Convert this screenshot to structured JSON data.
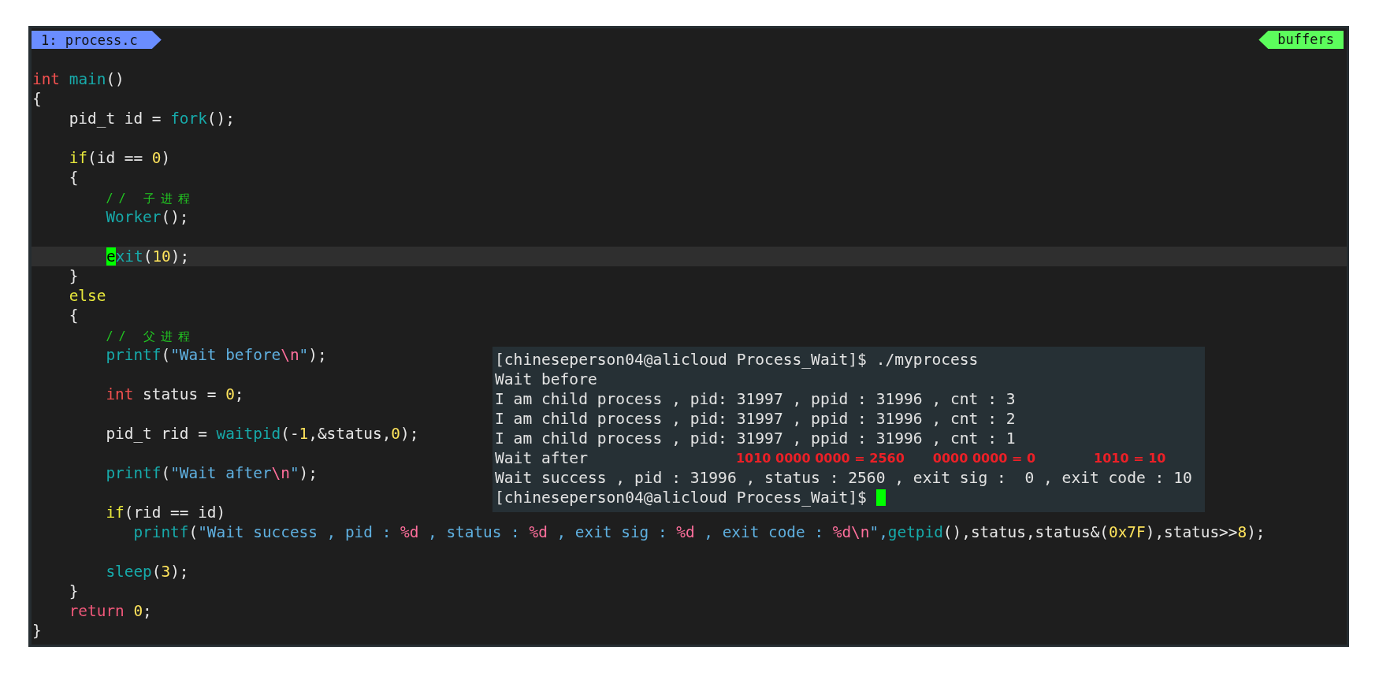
{
  "tabline": {
    "tabs": [
      {
        "label": "1: process.c",
        "selected": true
      }
    ],
    "buffers_label": "buffers"
  },
  "code": {
    "lines": [
      {
        "current": false,
        "tokens": [
          {
            "text": "int",
            "kind": "type"
          },
          {
            "text": " main",
            "kind": "func"
          },
          {
            "text": "()",
            "kind": "plain"
          }
        ]
      },
      {
        "current": false,
        "tokens": [
          {
            "text": "{",
            "kind": "plain"
          }
        ]
      },
      {
        "current": false,
        "tokens": [
          {
            "text": "    pid_t id = ",
            "kind": "plain"
          },
          {
            "text": "fork",
            "kind": "func"
          },
          {
            "text": "();",
            "kind": "plain"
          }
        ]
      },
      {
        "current": false
      },
      {
        "current": false,
        "tokens": [
          {
            "text": "    if",
            "kind": "cond"
          },
          {
            "text": "(id == ",
            "kind": "plain"
          },
          {
            "text": "0",
            "kind": "number"
          },
          {
            "text": ")",
            "kind": "plain"
          }
        ]
      },
      {
        "current": false,
        "tokens": [
          {
            "text": "    {",
            "kind": "plain"
          }
        ]
      },
      {
        "current": false,
        "tokens": [
          {
            "text": "        // 子进程",
            "kind": "comment"
          }
        ]
      },
      {
        "current": false,
        "tokens": [
          {
            "text": "        Worker",
            "kind": "func"
          },
          {
            "text": "();",
            "kind": "plain"
          }
        ]
      },
      {
        "current": false
      },
      {
        "current": true,
        "tokens": [
          {
            "text": "e",
            "kind": "cursor"
          },
          {
            "text": "xit",
            "kind": "func"
          },
          {
            "text": "(",
            "kind": "plain"
          },
          {
            "text": "10",
            "kind": "number"
          },
          {
            "text": ");",
            "kind": "plain"
          }
        ]
      },
      {
        "current": false,
        "tokens": [
          {
            "text": "    }",
            "kind": "plain"
          }
        ]
      },
      {
        "current": false,
        "tokens": [
          {
            "text": "    else",
            "kind": "cond"
          }
        ]
      },
      {
        "current": false,
        "tokens": [
          {
            "text": "    {",
            "kind": "plain"
          }
        ]
      },
      {
        "current": false,
        "tokens": [
          {
            "text": "        // 父进程",
            "kind": "comment"
          }
        ]
      },
      {
        "current": false,
        "tokens": [
          {
            "text": "        printf",
            "kind": "func"
          },
          {
            "text": "(",
            "kind": "plain"
          },
          {
            "text": "\"Wait before",
            "kind": "string"
          },
          {
            "text": "\\n",
            "kind": "escape"
          },
          {
            "text": "\"",
            "kind": "string"
          },
          {
            "text": ");",
            "kind": "plain"
          }
        ]
      },
      {
        "current": false
      },
      {
        "current": false,
        "tokens": [
          {
            "text": "        int",
            "kind": "type"
          },
          {
            "text": " status = ",
            "kind": "plain"
          },
          {
            "text": "0",
            "kind": "number"
          },
          {
            "text": ";",
            "kind": "plain"
          }
        ]
      },
      {
        "current": false
      },
      {
        "current": false,
        "tokens": [
          {
            "text": "        pid_t rid = ",
            "kind": "plain"
          },
          {
            "text": "waitpid",
            "kind": "func"
          },
          {
            "text": "(-",
            "kind": "plain"
          },
          {
            "text": "1",
            "kind": "number"
          },
          {
            "text": ",&status,",
            "kind": "plain"
          },
          {
            "text": "0",
            "kind": "number"
          },
          {
            "text": ");",
            "kind": "plain"
          }
        ]
      },
      {
        "current": false
      },
      {
        "current": false,
        "tokens": [
          {
            "text": "        printf",
            "kind": "func"
          },
          {
            "text": "(",
            "kind": "plain"
          },
          {
            "text": "\"Wait after",
            "kind": "string"
          },
          {
            "text": "\\n",
            "kind": "escape"
          },
          {
            "text": "\"",
            "kind": "string"
          },
          {
            "text": ");",
            "kind": "plain"
          }
        ]
      },
      {
        "current": false
      },
      {
        "current": false,
        "tokens": [
          {
            "text": "        if",
            "kind": "cond"
          },
          {
            "text": "(rid == id)",
            "kind": "plain"
          }
        ]
      },
      {
        "current": false,
        "tokens": [
          {
            "text": "           printf",
            "kind": "func"
          },
          {
            "text": "(",
            "kind": "plain"
          },
          {
            "text": "\"Wait success , pid : ",
            "kind": "string"
          },
          {
            "text": "%d",
            "kind": "escape"
          },
          {
            "text": " , status : ",
            "kind": "string"
          },
          {
            "text": "%d",
            "kind": "escape"
          },
          {
            "text": " , exit sig : ",
            "kind": "string"
          },
          {
            "text": "%d",
            "kind": "escape"
          },
          {
            "text": " , exit code : ",
            "kind": "string"
          },
          {
            "text": "%d\\n",
            "kind": "escape"
          },
          {
            "text": "\",",
            "kind": "string"
          },
          {
            "text": "getpid",
            "kind": "func"
          },
          {
            "text": "(),status,status&(",
            "kind": "plain"
          },
          {
            "text": "0x7F",
            "kind": "number"
          },
          {
            "text": "),status>>",
            "kind": "plain"
          },
          {
            "text": "8",
            "kind": "number"
          },
          {
            "text": ");",
            "kind": "plain"
          }
        ]
      },
      {
        "current": false
      },
      {
        "current": false,
        "tokens": [
          {
            "text": "        sleep",
            "kind": "func"
          },
          {
            "text": "(",
            "kind": "plain"
          },
          {
            "text": "3",
            "kind": "number"
          },
          {
            "text": ");",
            "kind": "plain"
          }
        ]
      },
      {
        "current": false,
        "tokens": [
          {
            "text": "    }",
            "kind": "plain"
          }
        ]
      },
      {
        "current": false,
        "tokens": [
          {
            "text": "    return",
            "kind": "keyword"
          },
          {
            "text": " 0",
            "kind": "number"
          },
          {
            "text": ";",
            "kind": "plain"
          }
        ]
      },
      {
        "current": false,
        "tokens": [
          {
            "text": "}",
            "kind": "plain"
          }
        ]
      }
    ]
  },
  "terminal": {
    "lines": [
      {
        "text": "[chineseperson04@alicloud Process_Wait]$ ./myprocess"
      },
      {
        "text": "Wait before"
      },
      {
        "text": "I am child process , pid: 31997 , ppid : 31996 , cnt : 3"
      },
      {
        "text": "I am child process , pid: 31997 , ppid : 31996 , cnt : 2"
      },
      {
        "text": "I am child process , pid: 31997 , ppid : 31996 , cnt : 1"
      },
      {
        "text": "Wait after",
        "annotations": [
          "1010 0000 0000 = 2560",
          "0000 0000 = 0",
          "1010 = 10"
        ]
      },
      {
        "text": "Wait success , pid : 31996 , status : 2560 , exit sig :  0 , exit code : 10"
      },
      {
        "text": "[chineseperson04@alicloud Process_Wait]$",
        "cursor": true
      }
    ]
  }
}
